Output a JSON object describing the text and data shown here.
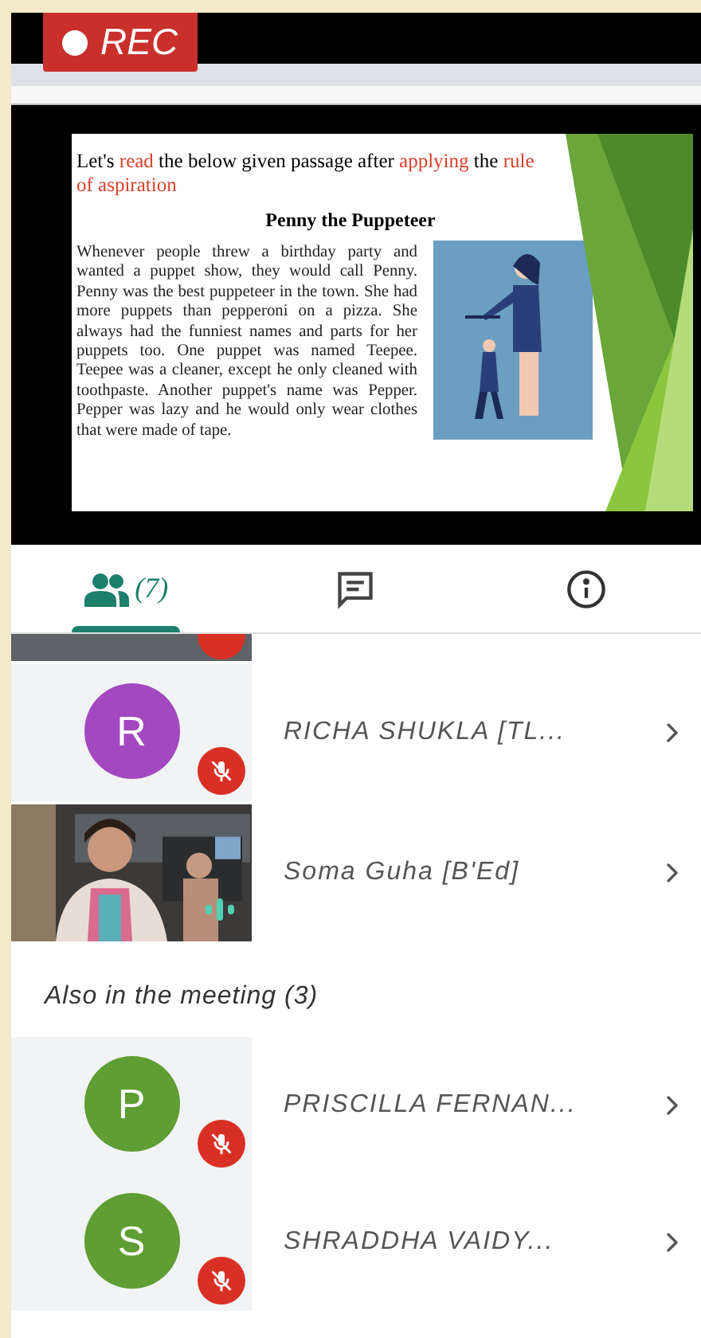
{
  "recording": {
    "label": "REC"
  },
  "slide": {
    "heading": [
      {
        "text": "Let's ",
        "highlight": false
      },
      {
        "text": "read",
        "highlight": true
      },
      {
        "text": " the below given passage after ",
        "highlight": false
      },
      {
        "text": "applying",
        "highlight": true
      },
      {
        "text": " the ",
        "highlight": false
      },
      {
        "text": "rule of aspiration",
        "highlight": true
      }
    ],
    "title": "Penny the Puppeteer",
    "passage": "Whenever people threw a birthday party and wanted a puppet show, they would call Penny. Penny was the best puppeteer in the town. She had more puppets than pepperoni on a pizza. She always had the funniest names and parts for her puppets too. One puppet was named Teepee. Teepee was a cleaner, except he only cleaned with toothpaste. Another puppet's name was Pepper. Pepper was lazy and he would only wear clothes that were made of tape."
  },
  "tabs": [
    {
      "kind": "people",
      "count": "(7)",
      "selected": true
    },
    {
      "kind": "chat",
      "selected": false
    },
    {
      "kind": "info",
      "selected": false
    }
  ],
  "cut_off_row": {
    "muted": true
  },
  "participants": [
    {
      "kind": "avatar",
      "initial": "R",
      "color": "#a349c0",
      "name": "RICHA SHUKLA [TL...",
      "muted": true,
      "speaking": false
    },
    {
      "kind": "video",
      "name": "Soma Guha [B'Ed]",
      "muted": false,
      "speaking": true
    }
  ],
  "also_header": "Also in the meeting (3)",
  "also": [
    {
      "kind": "avatar",
      "initial": "P",
      "color": "#5e9e34",
      "name": "PRISCILLA FERNAN...",
      "muted": true,
      "speaking": false
    },
    {
      "kind": "avatar",
      "initial": "S",
      "color": "#5e9e34",
      "name": "SHRADDHA VAIDY...",
      "muted": true,
      "speaking": false
    }
  ]
}
